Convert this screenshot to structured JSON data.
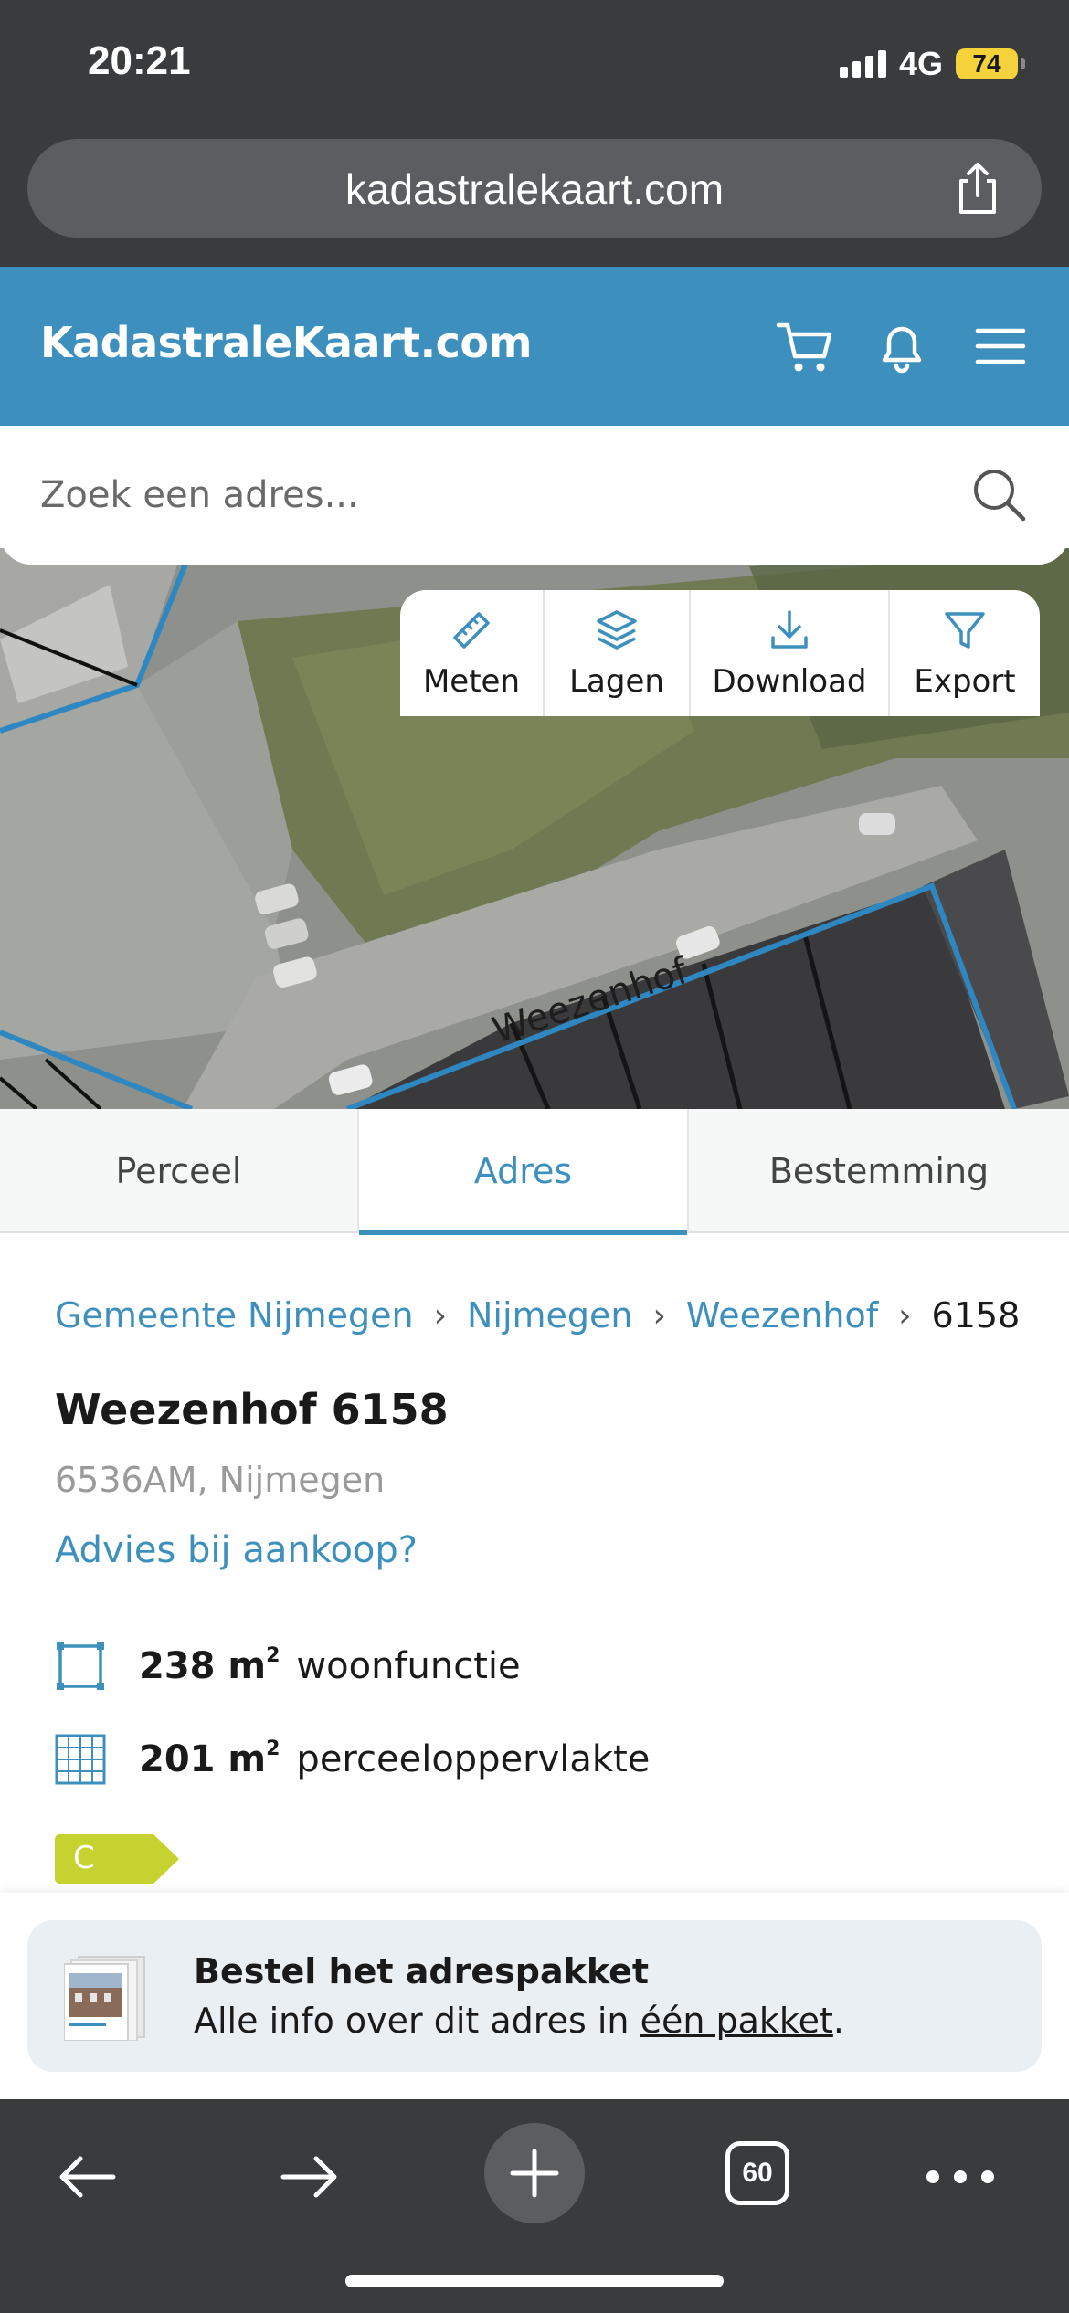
{
  "status": {
    "time": "20:21",
    "network": "4G",
    "battery": "74"
  },
  "browser": {
    "url": "kadastralekaart.com",
    "tab_count": "60"
  },
  "site": {
    "logo": "KadastraleKaart.com"
  },
  "search": {
    "placeholder": "Zoek een adres..."
  },
  "map": {
    "street_label": "Weezenhof",
    "tools": [
      {
        "label": "Meten",
        "icon": "ruler-icon"
      },
      {
        "label": "Lagen",
        "icon": "layers-icon"
      },
      {
        "label": "Download",
        "icon": "download-icon"
      },
      {
        "label": "Export",
        "icon": "filter-icon"
      }
    ]
  },
  "tabs": [
    {
      "label": "Perceel",
      "active": false
    },
    {
      "label": "Adres",
      "active": true
    },
    {
      "label": "Bestemming",
      "active": false
    }
  ],
  "breadcrumb": {
    "items": [
      "Gemeente Nijmegen",
      "Nijmegen",
      "Weezenhof"
    ],
    "current": "6158"
  },
  "address": {
    "title": "Weezenhof 6158",
    "postal_city": "6536AM, Nijmegen",
    "advice_link": "Advies bij aankoop?"
  },
  "stats": [
    {
      "value": "238 m",
      "unit_sup": "2",
      "label": "woonfunctie",
      "icon": "floor-area-icon"
    },
    {
      "value": "201 m",
      "unit_sup": "2",
      "label": "perceeloppervlakte",
      "icon": "parcel-grid-icon"
    }
  ],
  "energy_label": {
    "value": "C",
    "color": "#c5d230"
  },
  "banner": {
    "title": "Bestel het adrespakket",
    "desc_prefix": "Alle info over dit adres in ",
    "desc_link": "één pakket",
    "desc_suffix": "."
  },
  "colors": {
    "brand": "#3d8fbe",
    "chrome": "#3a3b3d"
  }
}
